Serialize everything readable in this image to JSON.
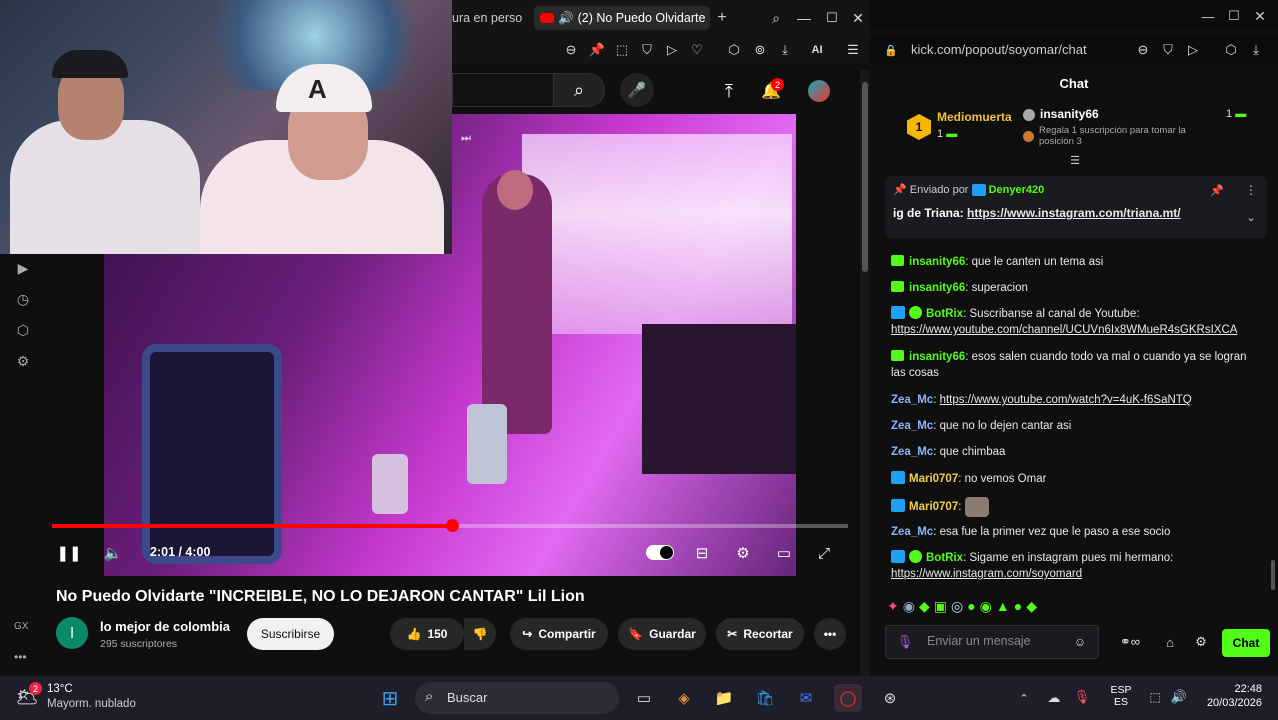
{
  "left_browser": {
    "tabs": [
      {
        "label": "ura en perso",
        "active": false
      },
      {
        "label": "(2) No Puedo Olvidarte",
        "active": true
      }
    ],
    "new_tab_label": "+",
    "aria_label": "AI"
  },
  "youtube": {
    "notification_count": "2",
    "time_current": "2:01 / 4:00",
    "progress": 0.503,
    "video_title": "No Puedo Olvidarte \"INCREIBLE, NO LO DEJARON CANTAR\" Lil Lion",
    "channel_initial": "l",
    "channel_name": "lo mejor de colombia",
    "channel_subs": "295 suscriptores",
    "subscribe_label": "Suscribirse",
    "like_count": "150",
    "share_label": "Compartir",
    "save_label": "Guardar",
    "clip_label": "Recortar",
    "sidebar_gx": "GX",
    "sidebar_more": "•••"
  },
  "chat_window": {
    "url": "kick.com/popout/soyomar/chat",
    "title": "Chat",
    "leaderboard": {
      "first_user": "Mediomuerta",
      "first_rank": "1",
      "first_count": "1",
      "second_user": "insanity66",
      "second_count": "1",
      "hint": "Regala 1 suscripción para tomar la posición 3"
    },
    "pinned": {
      "sent_by_label": "Enviado por",
      "sender": "Denyer420",
      "text_prefix": "ig de Triana:",
      "link": "https://www.instagram.com/triana.mt/"
    },
    "messages": [
      {
        "user": "insanity66",
        "color": "#53fc18",
        "text": "que le canten un tema asi"
      },
      {
        "user": "insanity66",
        "color": "#53fc18",
        "text": "superacion"
      },
      {
        "user": "BotRix",
        "color": "#53fc18",
        "text": "Suscribanse al canal de Youtube:",
        "link": "https://www.youtube.com/channel/UCUVn6Ix8WMueR4sGKRsIXCA"
      },
      {
        "user": "insanity66",
        "color": "#53fc18",
        "text": "esos salen cuando todo va mal o cuando ya se logran las cosas"
      },
      {
        "user": "Zea_Mc",
        "color": "#8ab4f8",
        "text": "",
        "link": "https://www.youtube.com/watch?v=4uK-f6SaNTQ"
      },
      {
        "user": "Zea_Mc",
        "color": "#8ab4f8",
        "text": "que no lo dejen cantar asi"
      },
      {
        "user": "Zea_Mc",
        "color": "#8ab4f8",
        "text": "que chimbaa"
      },
      {
        "user": "Mari0707",
        "color": "#f0d050",
        "text": "no vemos Omar"
      },
      {
        "user": "Mari0707",
        "color": "#f0d050",
        "text": ""
      },
      {
        "user": "Zea_Mc",
        "color": "#8ab4f8",
        "text": "esa fue la primer vez que le paso a ese socio"
      },
      {
        "user": "BotRix",
        "color": "#53fc18",
        "text": "Sigame en instagram pues mi hermano:",
        "link": "https://www.instagram.com/soyomard"
      }
    ],
    "input_placeholder": "Enviar un mensaje",
    "send_label": "Chat"
  },
  "taskbar": {
    "weather_temp": "13°C",
    "weather_desc": "Mayorm. nublado",
    "weather_badge": "2",
    "search_placeholder": "Buscar",
    "lang_top": "ESP",
    "lang_bottom": "ES",
    "time": "22:48",
    "date": "20/03/2026"
  },
  "colors": {
    "kick_green": "#53fc18",
    "yt_red": "#ff0000"
  }
}
